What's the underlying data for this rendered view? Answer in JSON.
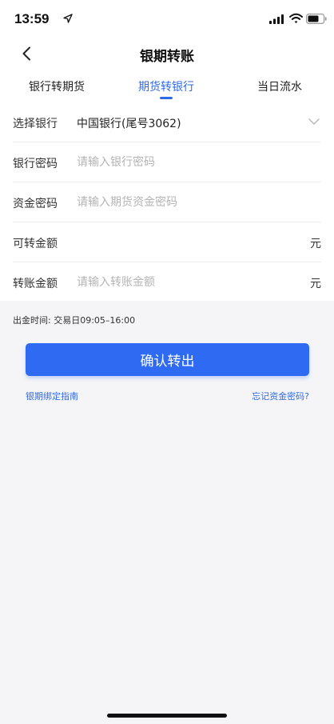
{
  "status_bar": {
    "time": "13:59"
  },
  "nav": {
    "title": "银期转账"
  },
  "tabs": [
    {
      "label": "银行转期货",
      "active": false
    },
    {
      "label": "期货转银行",
      "active": true
    },
    {
      "label": "当日流水",
      "active": false
    }
  ],
  "form": {
    "bank": {
      "label": "选择银行",
      "value": "中国银行(尾号3062)"
    },
    "bank_password": {
      "label": "银行密码",
      "placeholder": "请输入银行密码"
    },
    "fund_password": {
      "label": "资金密码",
      "placeholder": "请输入期货资金密码"
    },
    "transferable": {
      "label": "可转金额",
      "value": "",
      "unit": "元"
    },
    "amount": {
      "label": "转账金额",
      "placeholder": "请输入转账金额",
      "unit": "元"
    }
  },
  "hours_note": "出金时间: 交易日09:05–16:00",
  "confirm_label": "确认转出",
  "links": {
    "guide": "银期绑定指南",
    "forgot": "忘记资金密码?"
  },
  "colors": {
    "accent": "#2f6bf2",
    "background": "#f5f5f7"
  }
}
